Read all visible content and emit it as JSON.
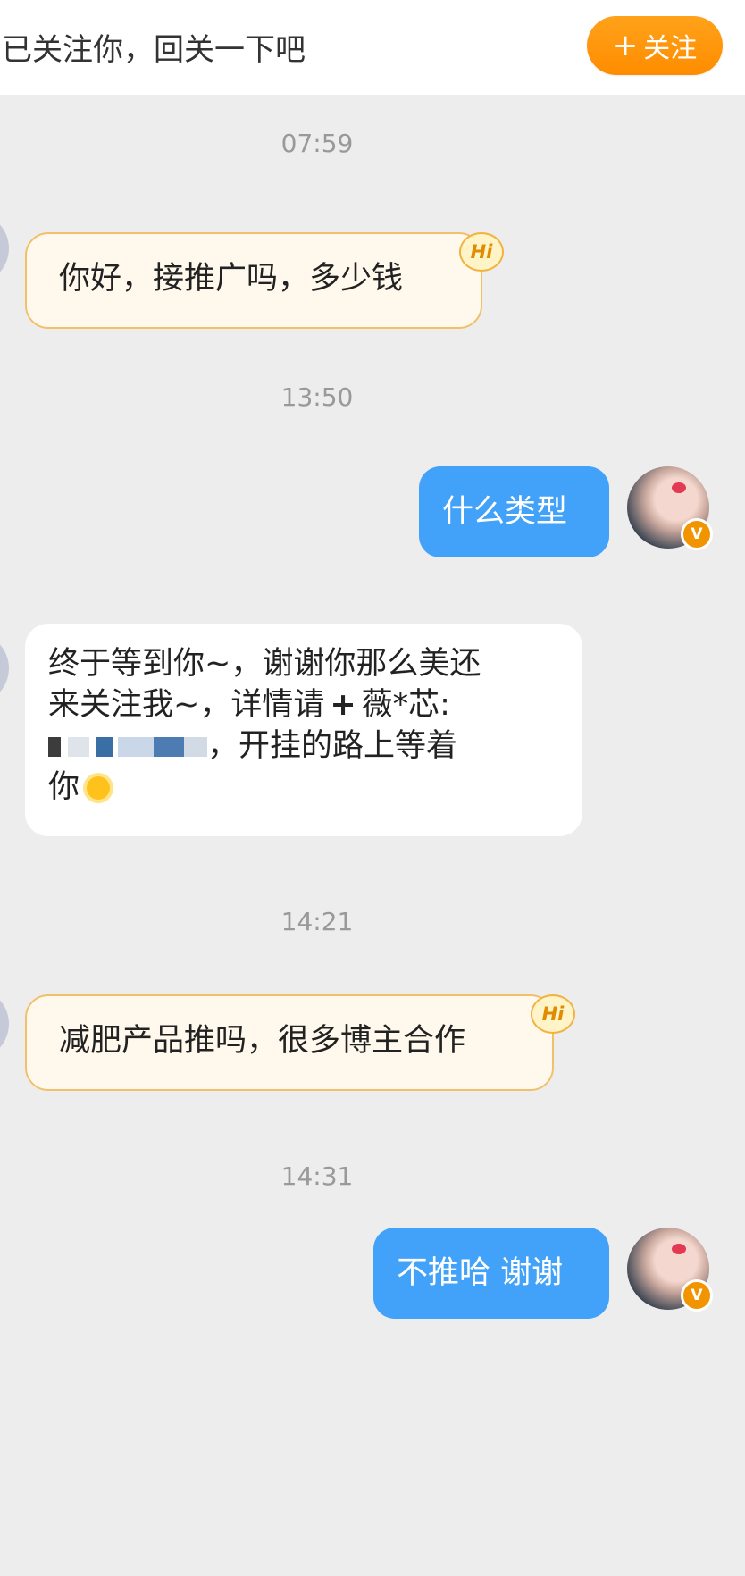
{
  "header": {
    "prompt": "已关注你，回关一下吧",
    "follow_plus": "+",
    "follow_label": "关注"
  },
  "messages": [
    {
      "time": "07:59",
      "side": "left",
      "style": "hi",
      "text": "你好，接推广吗，多少钱",
      "badge": "Hi"
    },
    {
      "time": "13:50",
      "side": "right",
      "text": "什么类型",
      "verified": "V"
    },
    {
      "side": "left",
      "style": "plain",
      "line1": "终于等到你~，谢谢你那么美还",
      "line2": "来关注我~，详情请",
      "line2_plus": "+",
      "line2_tail": "薇*芯:",
      "line3_tail": "，开挂的路上等着",
      "line4": "你"
    },
    {
      "time": "14:21",
      "side": "left",
      "style": "hi",
      "text": "减肥产品推吗，很多博主合作",
      "badge": "Hi"
    },
    {
      "time": "14:31",
      "side": "right",
      "text": "不推哈 谢谢",
      "verified": "V"
    }
  ],
  "colors": {
    "background": "#ededed",
    "follow_button": "#ff9a10",
    "outgoing_bubble": "#42a1f8",
    "greeting_bubble": "#fff8ec",
    "greeting_border": "#f2c06a",
    "timestamp": "#999999"
  },
  "icons": {
    "hi_badge": "hi-badge-icon",
    "verified": "verified-badge-icon",
    "sun": "sun-emoji"
  }
}
